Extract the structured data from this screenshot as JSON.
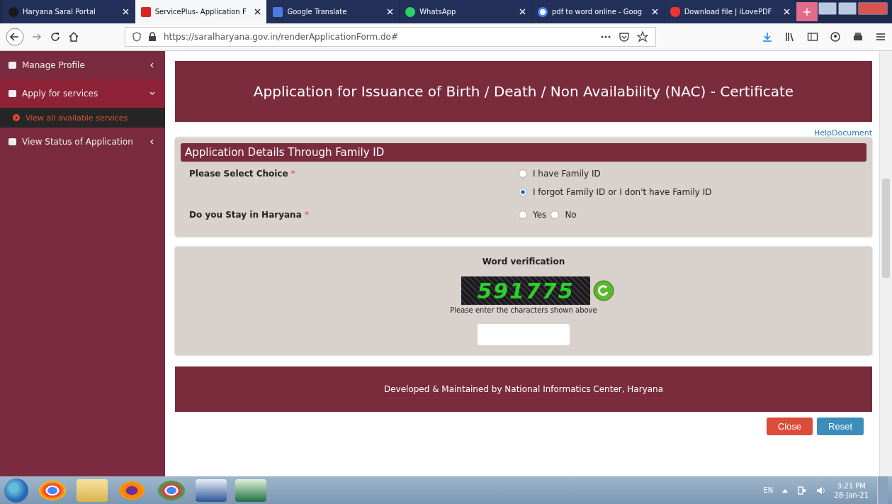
{
  "browser": {
    "tabs": [
      {
        "title": "Haryana Saral Portal",
        "selected": false
      },
      {
        "title": "ServicePlus- Application F",
        "selected": true
      },
      {
        "title": "Google Translate",
        "selected": false
      },
      {
        "title": "WhatsApp",
        "selected": false
      },
      {
        "title": "pdf to word online - Goog",
        "selected": false
      },
      {
        "title": "Download file | iLovePDF",
        "selected": false
      }
    ],
    "url": "https://saralharyana.gov.in/renderApplicationForm.do#"
  },
  "sidebar": {
    "items": [
      {
        "label": "Manage Profile",
        "expanded": false
      },
      {
        "label": "Apply for services",
        "expanded": true,
        "children": [
          {
            "label": "View all available services"
          }
        ]
      },
      {
        "label": "View Status of Application",
        "expanded": false
      }
    ]
  },
  "page": {
    "title": "Application for Issuance of Birth / Death / Non Availability (NAC) - Certificate",
    "help_link": "HelpDocument",
    "section_title": "Application Details Through Family ID",
    "questions": [
      {
        "label": "Please Select Choice",
        "required_mark": "*",
        "kind": "stacked",
        "options": [
          {
            "label": "I have Family ID",
            "selected": false
          },
          {
            "label": "I forgot Family ID or I don't have Family ID",
            "selected": true
          }
        ]
      },
      {
        "label": "Do you Stay in Haryana",
        "required_mark": "*",
        "kind": "inline",
        "options": [
          {
            "label": "Yes",
            "selected": false
          },
          {
            "label": "No",
            "selected": false
          }
        ]
      }
    ],
    "captcha": {
      "title": "Word verification",
      "code": "591775",
      "hint": "Please enter the characters shown above"
    },
    "footer": "Developed & Maintained by National Informatics Center, Haryana",
    "buttons": [
      {
        "label": "Close",
        "kind": "danger"
      },
      {
        "label": "Reset",
        "kind": "primary"
      }
    ]
  },
  "taskbar": {
    "language": "EN",
    "time": "3:21 PM",
    "date": "28-Jan-21"
  }
}
